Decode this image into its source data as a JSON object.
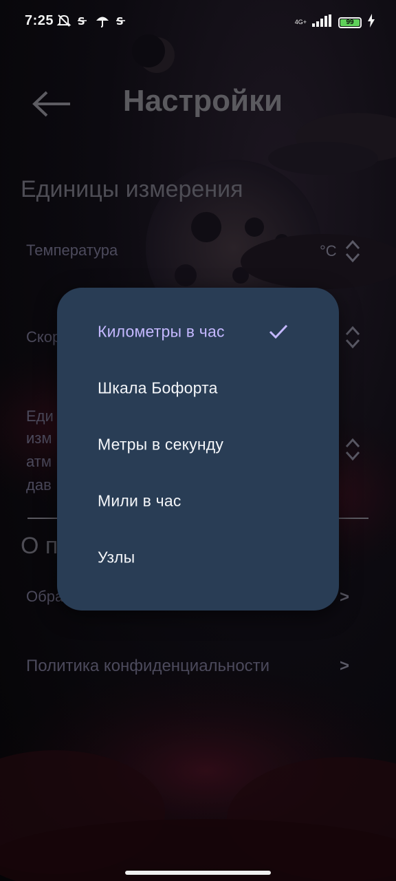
{
  "status_bar": {
    "time": "7:25",
    "network": "4G+",
    "battery": "99",
    "icons": [
      "muted-bell-icon",
      "sim-icon",
      "umbrella-icon",
      "sim-icon"
    ]
  },
  "header": {
    "back_icon": "back-arrow-icon",
    "title": "Настройки"
  },
  "units_section": {
    "title": "Единицы измерения",
    "temperature": {
      "label": "Температура",
      "value": "°C"
    },
    "wind_speed": {
      "label_fragment": "Скор"
    },
    "pressure": {
      "label_lines": [
        "Еди",
        "изм",
        "атм",
        "дав"
      ]
    }
  },
  "about_section": {
    "title_fragment": "О п",
    "feedback_fragment": "Обра",
    "privacy": "Политика конфиденциальности"
  },
  "dropdown": {
    "items": [
      {
        "label": "Километры в час",
        "selected": true
      },
      {
        "label": "Шкала Бофорта",
        "selected": false
      },
      {
        "label": "Метры в секунду",
        "selected": false
      },
      {
        "label": "Мили в час",
        "selected": false
      },
      {
        "label": "Узлы",
        "selected": false
      }
    ],
    "accent_color": "#c4b8ff",
    "background_color": "#293d55"
  }
}
